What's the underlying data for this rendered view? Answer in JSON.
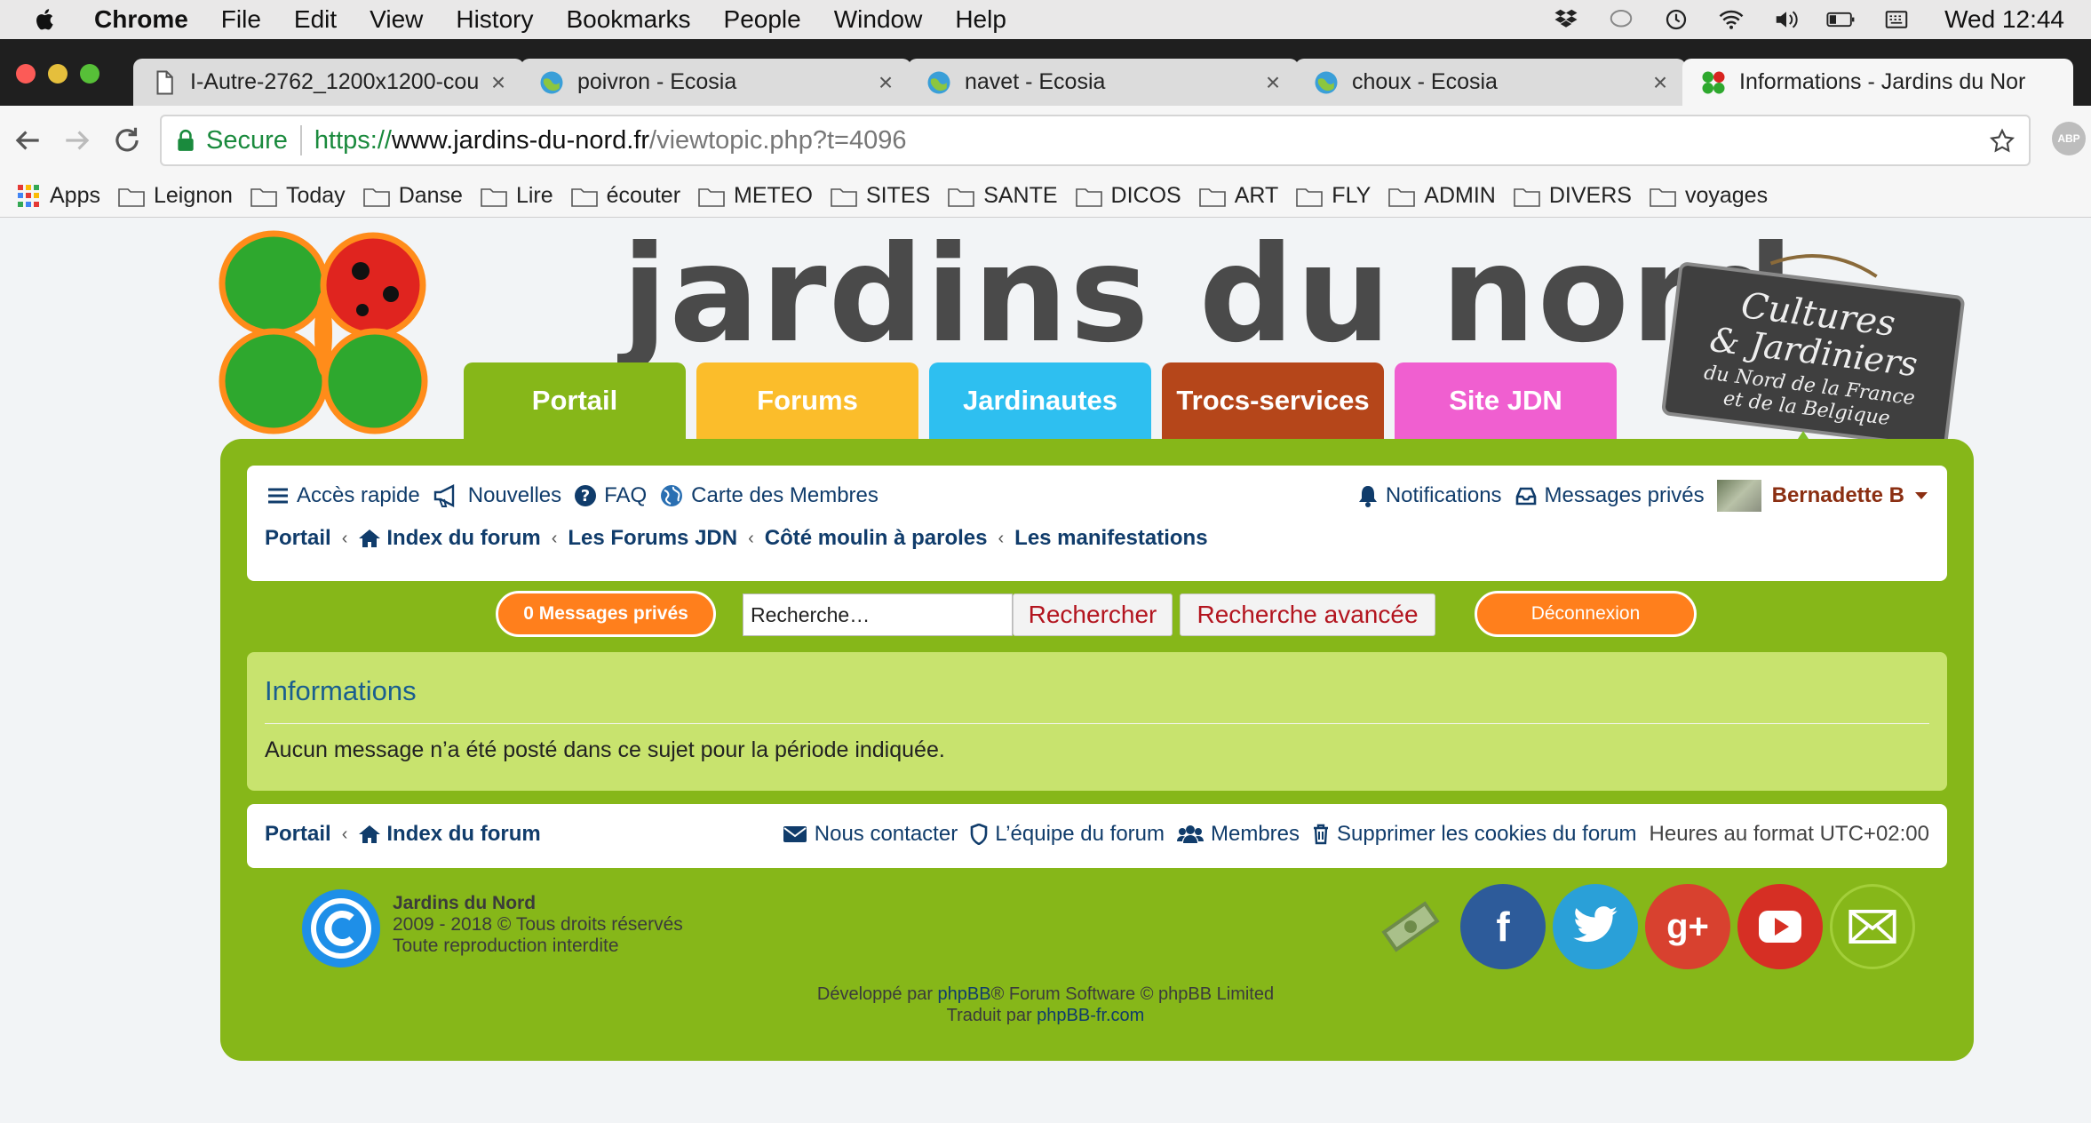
{
  "menubar": {
    "app": "Chrome",
    "items": [
      "File",
      "Edit",
      "View",
      "History",
      "Bookmarks",
      "People",
      "Window",
      "Help"
    ],
    "clock": "Wed 12:44"
  },
  "tabs": [
    {
      "label": "I-Autre-2762_1200x1200-cou",
      "favicon": "document-icon"
    },
    {
      "label": "poivron - Ecosia",
      "favicon": "ecosia-icon"
    },
    {
      "label": "navet - Ecosia",
      "favicon": "ecosia-icon"
    },
    {
      "label": "choux - Ecosia",
      "favicon": "ecosia-icon"
    },
    {
      "label": "Informations - Jardins du Nor",
      "favicon": "jdn-icon"
    }
  ],
  "omnibox": {
    "secure": "Secure",
    "proto": "https://",
    "host": "www.jardins-du-nord.fr",
    "path": "/viewtopic.php?t=4096"
  },
  "extension": "ABP",
  "bookmarks": [
    "Apps",
    "Leignon",
    "Today",
    "Danse",
    "Lire",
    "écouter",
    "METEO",
    "SITES",
    "SANTE",
    "DICOS",
    "ART",
    "FLY",
    "ADMIN",
    "DIVERS",
    "voyages"
  ],
  "site": {
    "title": "jardins du nord",
    "slate": {
      "l1": "Cultures",
      "l2": "& Jardiniers",
      "l3": "du Nord de la France",
      "l4": "et de la Belgique"
    }
  },
  "navtabs": [
    {
      "label": "Portail",
      "color": "#86b719"
    },
    {
      "label": "Forums",
      "color": "#fbbd2b"
    },
    {
      "label": "Jardinautes",
      "color": "#2ebff0"
    },
    {
      "label": "Trocs-services",
      "color": "#b5461a"
    },
    {
      "label": "Site JDN",
      "color": "#f05fd0"
    }
  ],
  "quicklinks": {
    "acces": "Accès rapide",
    "nouvelles": "Nouvelles",
    "faq": "FAQ",
    "carte": "Carte des Membres",
    "notifications": "Notifications",
    "messages": "Messages privés",
    "user": "Bernadette B"
  },
  "breadcrumbs": [
    "Portail",
    "Index du forum",
    "Les Forums JDN",
    "Côté moulin à paroles",
    "Les manifestations"
  ],
  "actions": {
    "pm_button": "0 Messages privés",
    "search_placeholder": "Recherche…",
    "search_button": "Rechercher",
    "advanced_button": "Recherche avancée",
    "logout_button": "Déconnexion"
  },
  "info": {
    "title": "Informations",
    "text": "Aucun message n’a été posté dans ce sujet pour la période indiquée."
  },
  "footer": {
    "crumbs": [
      "Portail",
      "Index du forum"
    ],
    "contact": "Nous contacter",
    "team": "L’équipe du forum",
    "members": "Membres",
    "cookies": "Supprimer les cookies du forum",
    "timezone": "Heures au format UTC+02:00"
  },
  "copyright": {
    "l1": "Jardins du Nord",
    "l2": "2009 - 2018 © Tous droits réservés",
    "l3": "Toute reproduction interdite"
  },
  "credits": {
    "pre1": "Développé par ",
    "link1": "phpBB",
    "post1": "® Forum Software © phpBB Limited",
    "pre2": "Traduit par ",
    "link2": "phpBB-fr.com"
  },
  "socials": [
    {
      "name": "donate-icon",
      "color": "#6e8b4a"
    },
    {
      "name": "facebook-icon",
      "color": "#2d5b9a"
    },
    {
      "name": "twitter-icon",
      "color": "#2aa0d8"
    },
    {
      "name": "google-plus-icon",
      "color": "#d8412f"
    },
    {
      "name": "youtube-icon",
      "color": "#d62f24"
    },
    {
      "name": "mail-icon",
      "color": "#86b719"
    }
  ]
}
